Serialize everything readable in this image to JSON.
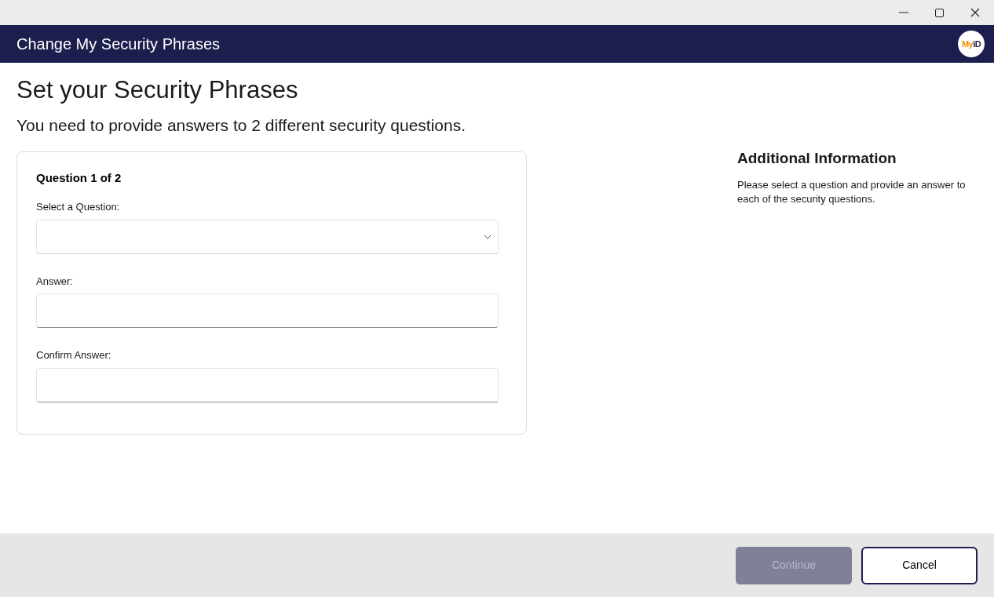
{
  "window": {
    "title": "Change My Security Phrases",
    "logo": [
      "My",
      "iD"
    ]
  },
  "heading": "Set your Security Phrases",
  "subheading": "You need to provide answers to 2 different security questions.",
  "question_card": {
    "title": "Question 1 of 2",
    "fields": [
      {
        "kind": "select",
        "label": "Select a Question:"
      },
      {
        "kind": "text",
        "label": "Answer:"
      },
      {
        "kind": "text",
        "label": "Confirm Answer:"
      }
    ]
  },
  "additional_info": {
    "title": "Additional Information",
    "text": "Please select a question and provide an answer to each of the security questions."
  },
  "buttons": [
    {
      "label": "Continue",
      "disabled": true
    },
    {
      "label": "Cancel",
      "disabled": false
    }
  ]
}
